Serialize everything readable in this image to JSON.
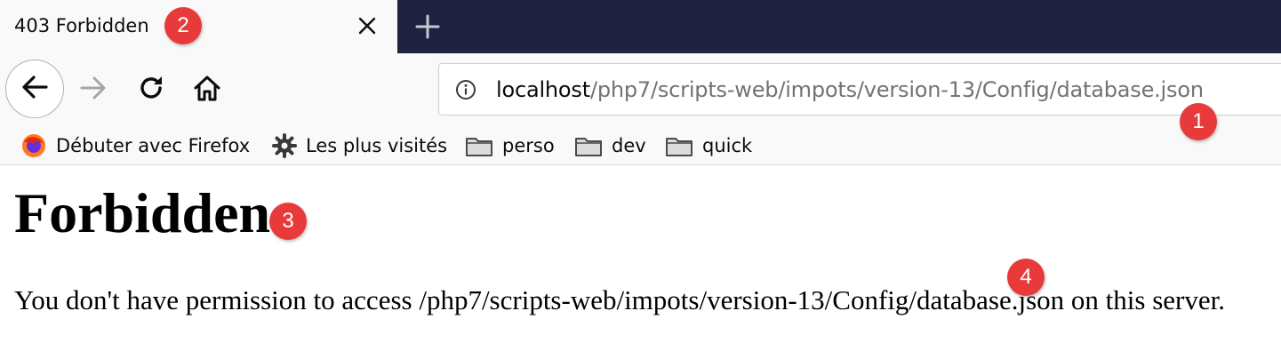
{
  "tab": {
    "title": "403 Forbidden",
    "close_icon": "close-icon",
    "new_tab_icon": "plus-icon"
  },
  "toolbar": {
    "back_icon": "arrow-left-icon",
    "forward_icon": "arrow-right-icon",
    "reload_icon": "reload-icon",
    "home_icon": "home-icon"
  },
  "urlbar": {
    "info_icon": "info-icon",
    "host": "localhost",
    "path": "/php7/scripts-web/impots/version-13/Config/database.json"
  },
  "bookmarks": [
    {
      "label": "Débuter avec Firefox",
      "icon": "firefox-icon"
    },
    {
      "label": "Les plus visités",
      "icon": "gear-icon"
    },
    {
      "label": "perso",
      "icon": "folder-icon"
    },
    {
      "label": "dev",
      "icon": "folder-icon"
    },
    {
      "label": "quick",
      "icon": "folder-icon"
    }
  ],
  "page": {
    "heading": "Forbidden",
    "message": "You don't have permission to access /php7/scripts-web/impots/version-13/Config/database.json on this server."
  },
  "markers": [
    "1",
    "2",
    "3",
    "4"
  ],
  "colors": {
    "tabstrip": "#1f2240",
    "toolbar": "#f9f9fa",
    "marker": "#e83a3a",
    "url_path": "#737373"
  }
}
